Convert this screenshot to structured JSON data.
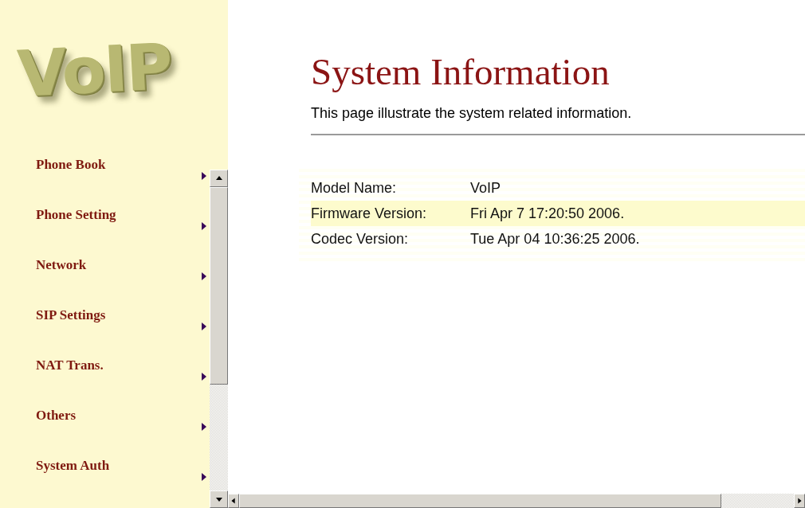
{
  "sidebar": {
    "logo": "VoIP",
    "items": [
      {
        "label": "Phone Book"
      },
      {
        "label": "Phone Setting"
      },
      {
        "label": "Network"
      },
      {
        "label": "SIP Settings"
      },
      {
        "label": "NAT Trans."
      },
      {
        "label": "Others"
      },
      {
        "label": "System Auth"
      }
    ]
  },
  "page": {
    "title": "System Information",
    "description": "This page illustrate the system related information.",
    "rows": [
      {
        "label": "Model Name:",
        "value": "VoIP",
        "highlighted": false
      },
      {
        "label": "Firmware Version:",
        "value": "Fri Apr 7 17:20:50 2006.",
        "highlighted": true
      },
      {
        "label": "Codec Version:",
        "value": "Tue Apr 04 10:36:25 2006.",
        "highlighted": false
      }
    ]
  }
}
